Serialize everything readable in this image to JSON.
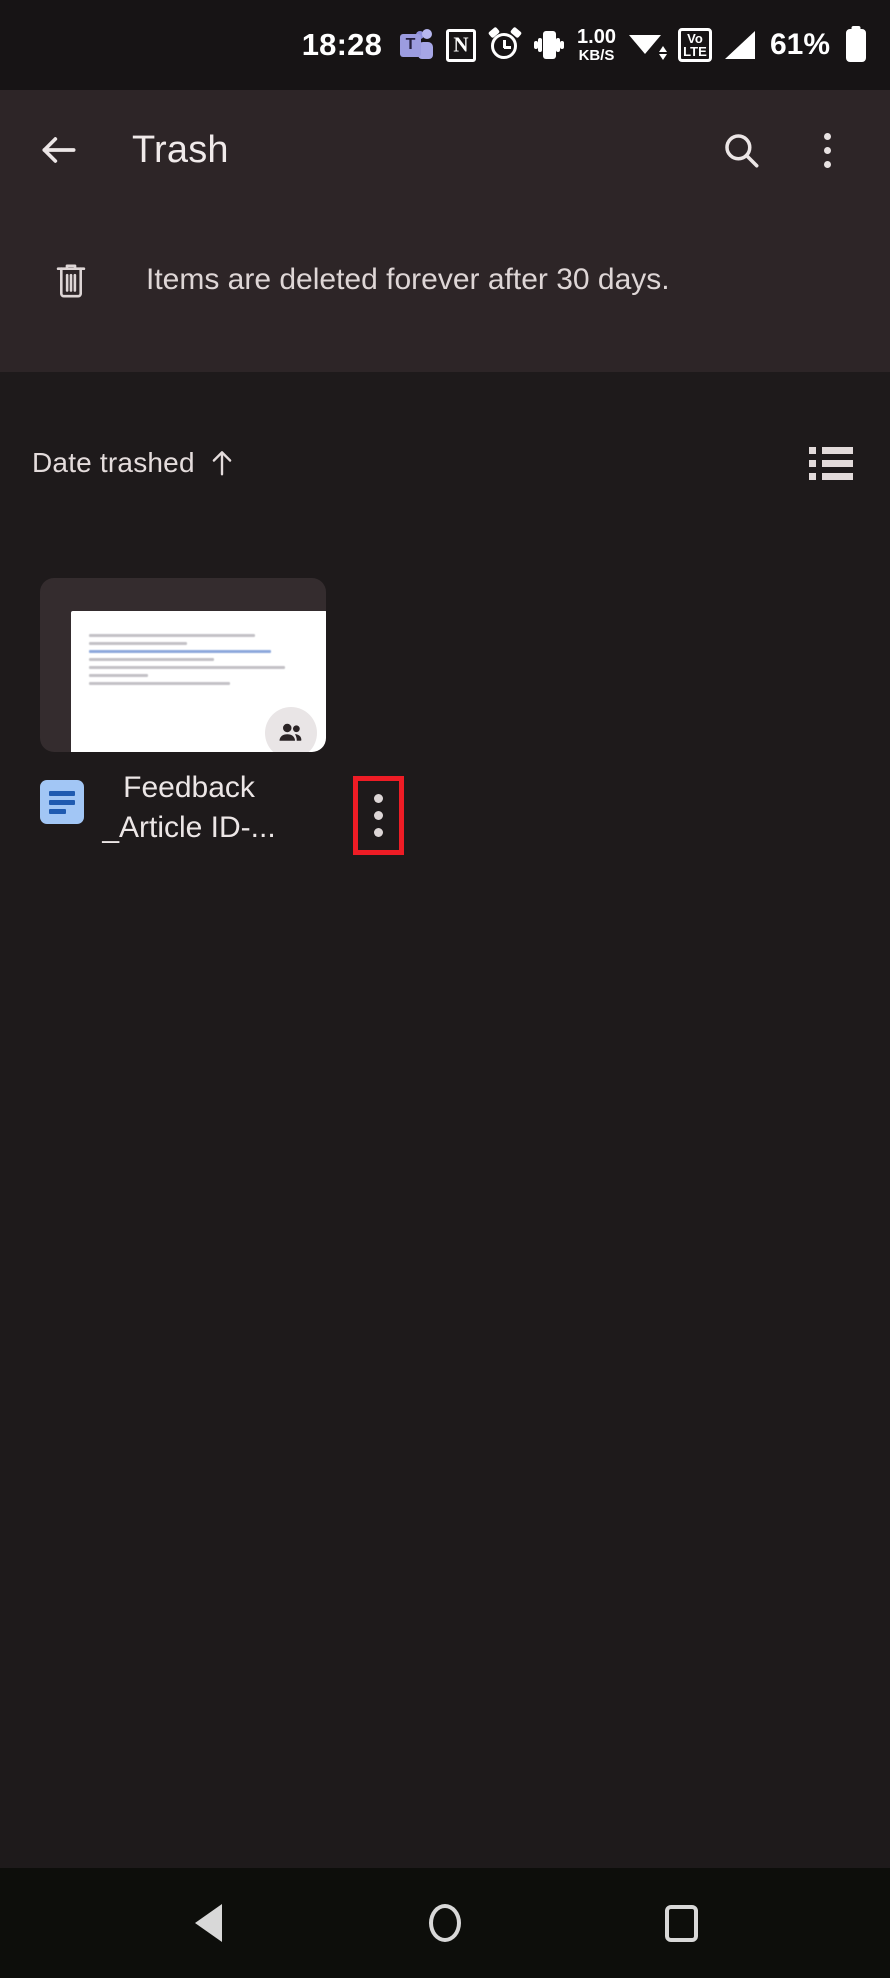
{
  "status_bar": {
    "time": "18:28",
    "icons": [
      {
        "name": "teams-icon",
        "label": "T"
      },
      {
        "name": "nfc-icon",
        "label": "N"
      },
      {
        "name": "alarm-icon",
        "label": ""
      },
      {
        "name": "vibrate-icon",
        "label": ""
      }
    ],
    "network_speed_value": "1.00",
    "network_speed_unit": "KB/S",
    "wifi": "wifi-icon",
    "volte_line1": "Vo",
    "volte_line2": "LTE",
    "signal": "signal-icon",
    "battery_percent": "61%"
  },
  "app_bar": {
    "back_icon": "back-arrow-icon",
    "title": "Trash",
    "search_icon": "search-icon",
    "overflow_icon": "overflow-menu-icon"
  },
  "banner": {
    "icon": "trash-can-icon",
    "message": "Items are deleted forever after 30 days."
  },
  "sort_row": {
    "label": "Date trashed",
    "direction_icon": "arrow-up-icon",
    "view_toggle_icon": "list-view-icon"
  },
  "files": [
    {
      "name": "Feedback _Article ID-...",
      "type_icon": "google-docs-icon",
      "shared_badge_icon": "people-shared-icon",
      "more_icon": "more-options-icon",
      "highlighted": true,
      "thumbnail_lines": [
        {
          "width": "73%",
          "link": false
        },
        {
          "width": "43%",
          "link": false
        },
        {
          "width": "80%",
          "link": true
        },
        {
          "width": "55%",
          "link": false
        },
        {
          "width": "86%",
          "link": false
        },
        {
          "width": "26%",
          "link": false
        },
        {
          "width": "62%",
          "link": false
        }
      ]
    }
  ],
  "nav_bar": {
    "back_icon": "nav-back-icon",
    "home_icon": "nav-home-icon",
    "recents_icon": "nav-recents-icon"
  },
  "colors": {
    "page_background": "#1e1a1b",
    "header_background": "#2d2527",
    "card_background": "#342c2e",
    "highlight_red": "#ee1c25",
    "docs_blue": "#a2c6f5",
    "text_primary": "#ece6e6"
  }
}
